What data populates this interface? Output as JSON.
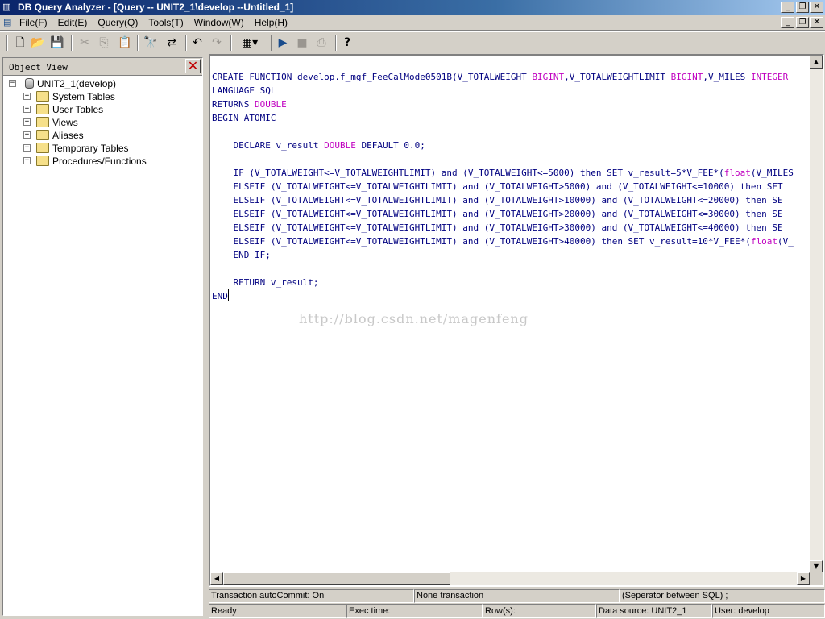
{
  "window": {
    "title": "DB Query Analyzer - [Query -- UNIT2_1\\develop  --Untitled_1]"
  },
  "icons": {
    "app": "db-query-analyzer-icon",
    "document": "query-document-icon"
  },
  "menu": [
    "File(F)",
    "Edit(E)",
    "Query(Q)",
    "Tools(T)",
    "Window(W)",
    "Help(H)"
  ],
  "toolbar": [
    {
      "name": "new-icon",
      "glyph": "🗋",
      "enabled": true
    },
    {
      "name": "open-folder-icon",
      "glyph": "📂",
      "enabled": true
    },
    {
      "name": "save-icon",
      "glyph": "💾",
      "enabled": true
    },
    {
      "name": "cut-icon",
      "glyph": "✂",
      "enabled": false
    },
    {
      "name": "copy-icon",
      "glyph": "⎘",
      "enabled": false
    },
    {
      "name": "paste-icon",
      "glyph": "📋",
      "enabled": true
    },
    {
      "name": "find-icon",
      "glyph": "🔭",
      "enabled": true
    },
    {
      "name": "replace-icon",
      "glyph": "⇄",
      "enabled": true
    },
    {
      "name": "undo-icon",
      "glyph": "↶",
      "enabled": true
    },
    {
      "name": "redo-icon",
      "glyph": "↷",
      "enabled": false
    },
    {
      "name": "results-grid-icon",
      "glyph": "▦▾",
      "enabled": true
    },
    {
      "name": "execute-icon",
      "glyph": "▶",
      "enabled": true
    },
    {
      "name": "stop-icon",
      "glyph": "■",
      "enabled": false
    },
    {
      "name": "parse-icon",
      "glyph": "⎙",
      "enabled": false
    },
    {
      "name": "help-icon",
      "glyph": "?",
      "enabled": true
    }
  ],
  "object_view": {
    "title": "Object View",
    "root": "UNIT2_1(develop)",
    "items": [
      "System Tables",
      "User Tables",
      "Views",
      "Aliases",
      "Temporary Tables",
      "Procedures/Functions"
    ]
  },
  "editor": {
    "watermark": "http://blog.csdn.net/magenfeng",
    "lines": [
      [
        [
          "k",
          "CREATE FUNCTION "
        ],
        [
          "k",
          "develop.f_mgf_FeeCalMode0501B(V_TOTALWEIGHT "
        ],
        [
          "t",
          "BIGINT"
        ],
        [
          "k",
          ",V_TOTALWEIGHTLIMIT "
        ],
        [
          "t",
          "BIGINT"
        ],
        [
          "k",
          ",V_MILES "
        ],
        [
          "t",
          "INTEGER"
        ]
      ],
      [
        [
          "k",
          "LANGUAGE SQL"
        ]
      ],
      [
        [
          "k",
          "RETURNS "
        ],
        [
          "t",
          "DOUBLE"
        ]
      ],
      [
        [
          "k",
          "BEGIN ATOMIC"
        ]
      ],
      [
        [
          "k",
          ""
        ]
      ],
      [
        [
          "k",
          "    DECLARE v_result "
        ],
        [
          "t",
          "DOUBLE"
        ],
        [
          "k",
          " DEFAULT 0.0;"
        ]
      ],
      [
        [
          "k",
          ""
        ]
      ],
      [
        [
          "k",
          "    IF (V_TOTALWEIGHT<=V_TOTALWEIGHTLIMIT) and (V_TOTALWEIGHT<=5000) then SET v_result=5*V_FEE*("
        ],
        [
          "t",
          "float"
        ],
        [
          "k",
          "(V_MILES"
        ]
      ],
      [
        [
          "k",
          "    ELSEIF (V_TOTALWEIGHT<=V_TOTALWEIGHTLIMIT) and (V_TOTALWEIGHT>5000) and (V_TOTALWEIGHT<=10000) then SET"
        ]
      ],
      [
        [
          "k",
          "    ELSEIF (V_TOTALWEIGHT<=V_TOTALWEIGHTLIMIT) and (V_TOTALWEIGHT>10000) and (V_TOTALWEIGHT<=20000) then SE"
        ]
      ],
      [
        [
          "k",
          "    ELSEIF (V_TOTALWEIGHT<=V_TOTALWEIGHTLIMIT) and (V_TOTALWEIGHT>20000) and (V_TOTALWEIGHT<=30000) then SE"
        ]
      ],
      [
        [
          "k",
          "    ELSEIF (V_TOTALWEIGHT<=V_TOTALWEIGHTLIMIT) and (V_TOTALWEIGHT>30000) and (V_TOTALWEIGHT<=40000) then SE"
        ]
      ],
      [
        [
          "k",
          "    ELSEIF (V_TOTALWEIGHT<=V_TOTALWEIGHTLIMIT) and (V_TOTALWEIGHT>40000) then SET v_result=10*V_FEE*("
        ],
        [
          "t",
          "float"
        ],
        [
          "k",
          "(V_"
        ]
      ],
      [
        [
          "k",
          "    END IF;"
        ]
      ],
      [
        [
          "k",
          ""
        ]
      ],
      [
        [
          "k",
          "    RETURN v_result;"
        ]
      ],
      [
        [
          "k",
          "END"
        ]
      ]
    ]
  },
  "status_top": {
    "autocommit": "Transaction autoCommit: On",
    "transaction": "None transaction",
    "separator": "(Seperator between SQL)  ;"
  },
  "status_bottom": {
    "state": "Ready",
    "exec_time": "Exec time:",
    "rows": "Row(s):",
    "data_source": "Data source: UNIT2_1",
    "user": "User: develop"
  },
  "colors": {
    "code": "#000080",
    "type_keyword": "#c000c0",
    "title_gradient_start": "#0a246a",
    "close_x": "#c00000"
  }
}
